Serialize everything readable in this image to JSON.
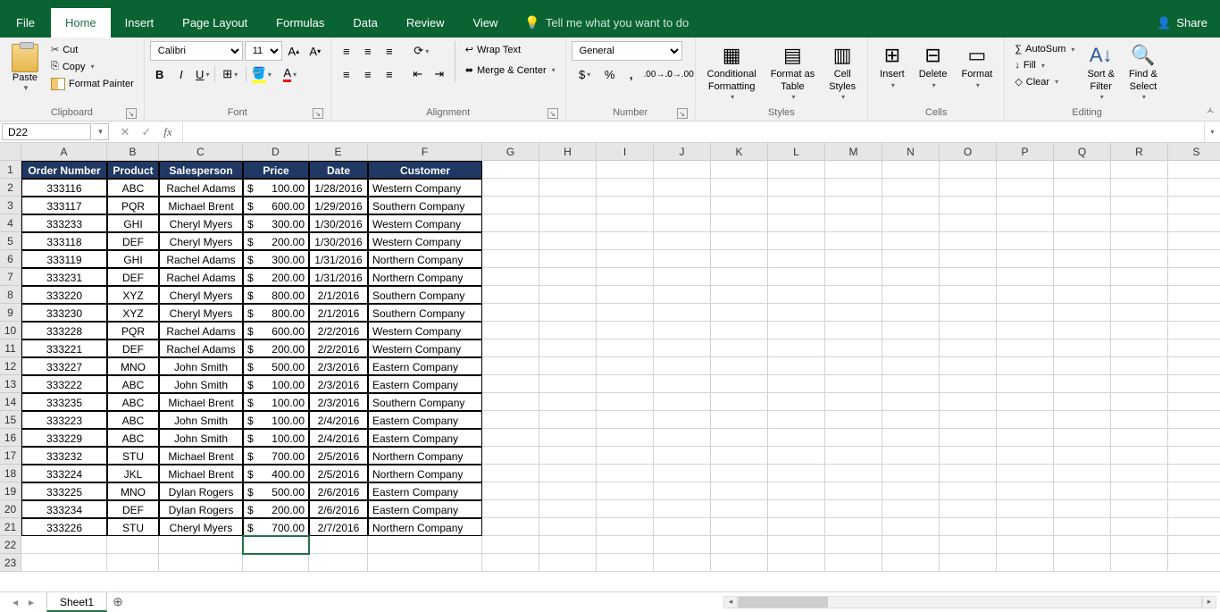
{
  "app": {
    "share": "Share"
  },
  "tabs": {
    "file": "File",
    "home": "Home",
    "insert": "Insert",
    "pageLayout": "Page Layout",
    "formulas": "Formulas",
    "data": "Data",
    "review": "Review",
    "view": "View",
    "tellme": "Tell me what you want to do"
  },
  "ribbon": {
    "clipboard": {
      "label": "Clipboard",
      "paste": "Paste",
      "cut": "Cut",
      "copy": "Copy",
      "formatPainter": "Format Painter"
    },
    "font": {
      "label": "Font",
      "name": "Calibri",
      "size": "11"
    },
    "alignment": {
      "label": "Alignment",
      "wrap": "Wrap Text",
      "merge": "Merge & Center"
    },
    "number": {
      "label": "Number",
      "format": "General"
    },
    "styles": {
      "label": "Styles",
      "cond": "Conditional\nFormatting",
      "table": "Format as\nTable",
      "cell": "Cell\nStyles"
    },
    "cells": {
      "label": "Cells",
      "insert": "Insert",
      "delete": "Delete",
      "format": "Format"
    },
    "editing": {
      "label": "Editing",
      "autosum": "AutoSum",
      "fill": "Fill",
      "clear": "Clear",
      "sort": "Sort &\nFilter",
      "find": "Find &\nSelect"
    }
  },
  "nameBox": "D22",
  "formula": "",
  "columns": [
    "A",
    "B",
    "C",
    "D",
    "E",
    "F",
    "G",
    "H",
    "I",
    "J",
    "K",
    "L",
    "M",
    "N",
    "O",
    "P",
    "Q",
    "R",
    "S"
  ],
  "headers": [
    "Order Number",
    "Product",
    "Salesperson",
    "Price",
    "Date",
    "Customer"
  ],
  "rows": [
    {
      "n": "333116",
      "p": "ABC",
      "s": "Rachel Adams",
      "pr": "100.00",
      "d": "1/28/2016",
      "c": "Western Company"
    },
    {
      "n": "333117",
      "p": "PQR",
      "s": "Michael Brent",
      "pr": "600.00",
      "d": "1/29/2016",
      "c": "Southern Company"
    },
    {
      "n": "333233",
      "p": "GHI",
      "s": "Cheryl Myers",
      "pr": "300.00",
      "d": "1/30/2016",
      "c": "Western Company"
    },
    {
      "n": "333118",
      "p": "DEF",
      "s": "Cheryl Myers",
      "pr": "200.00",
      "d": "1/30/2016",
      "c": "Western Company"
    },
    {
      "n": "333119",
      "p": "GHI",
      "s": "Rachel Adams",
      "pr": "300.00",
      "d": "1/31/2016",
      "c": "Northern Company"
    },
    {
      "n": "333231",
      "p": "DEF",
      "s": "Rachel Adams",
      "pr": "200.00",
      "d": "1/31/2016",
      "c": "Northern Company"
    },
    {
      "n": "333220",
      "p": "XYZ",
      "s": "Cheryl Myers",
      "pr": "800.00",
      "d": "2/1/2016",
      "c": "Southern Company"
    },
    {
      "n": "333230",
      "p": "XYZ",
      "s": "Cheryl Myers",
      "pr": "800.00",
      "d": "2/1/2016",
      "c": "Southern Company"
    },
    {
      "n": "333228",
      "p": "PQR",
      "s": "Rachel Adams",
      "pr": "600.00",
      "d": "2/2/2016",
      "c": "Western Company"
    },
    {
      "n": "333221",
      "p": "DEF",
      "s": "Rachel Adams",
      "pr": "200.00",
      "d": "2/2/2016",
      "c": "Western Company"
    },
    {
      "n": "333227",
      "p": "MNO",
      "s": "John Smith",
      "pr": "500.00",
      "d": "2/3/2016",
      "c": "Eastern Company"
    },
    {
      "n": "333222",
      "p": "ABC",
      "s": "John Smith",
      "pr": "100.00",
      "d": "2/3/2016",
      "c": "Eastern Company"
    },
    {
      "n": "333235",
      "p": "ABC",
      "s": "Michael Brent",
      "pr": "100.00",
      "d": "2/3/2016",
      "c": "Southern Company"
    },
    {
      "n": "333223",
      "p": "ABC",
      "s": "John Smith",
      "pr": "100.00",
      "d": "2/4/2016",
      "c": "Eastern Company"
    },
    {
      "n": "333229",
      "p": "ABC",
      "s": "John Smith",
      "pr": "100.00",
      "d": "2/4/2016",
      "c": "Eastern Company"
    },
    {
      "n": "333232",
      "p": "STU",
      "s": "Michael Brent",
      "pr": "700.00",
      "d": "2/5/2016",
      "c": "Northern Company"
    },
    {
      "n": "333224",
      "p": "JKL",
      "s": "Michael Brent",
      "pr": "400.00",
      "d": "2/5/2016",
      "c": "Northern Company"
    },
    {
      "n": "333225",
      "p": "MNO",
      "s": "Dylan Rogers",
      "pr": "500.00",
      "d": "2/6/2016",
      "c": "Eastern Company"
    },
    {
      "n": "333234",
      "p": "DEF",
      "s": "Dylan Rogers",
      "pr": "200.00",
      "d": "2/6/2016",
      "c": "Eastern Company"
    },
    {
      "n": "333226",
      "p": "STU",
      "s": "Cheryl Myers",
      "pr": "700.00",
      "d": "2/7/2016",
      "c": "Northern Company"
    }
  ],
  "sheetTab": "Sheet1",
  "selectedCell": "D22",
  "lastRow": 23
}
